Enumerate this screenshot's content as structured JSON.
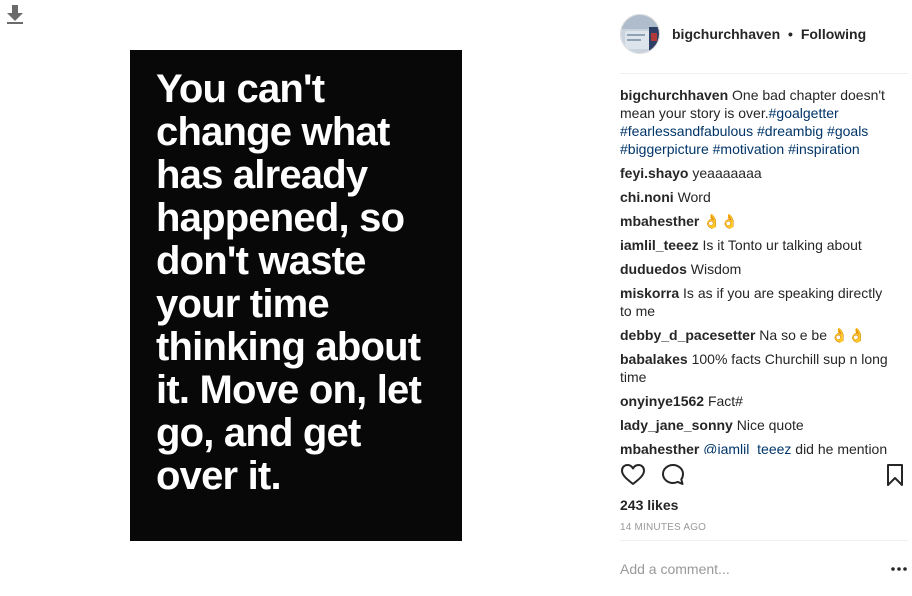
{
  "post": {
    "quote_lines": [
      "You can't",
      "change what",
      "has already",
      "happened, so",
      "don't waste",
      "your time",
      "thinking about",
      "it. Move on, let",
      "go, and get",
      "over it."
    ]
  },
  "header": {
    "username": "bigchurchhaven",
    "separator": "•",
    "follow_status": "Following"
  },
  "caption": {
    "username": "bigchurchhaven",
    "text": "One bad chapter doesn't mean your story is over.",
    "hashtags": [
      "#goalgetter",
      "#fearlessandfabulous",
      "#dreambig",
      "#goals",
      "#biggerpicture",
      "#motivation",
      "#inspiration"
    ]
  },
  "comments": [
    {
      "user": "feyi.shayo",
      "text": "yeaaaaaaa"
    },
    {
      "user": "chi.noni",
      "text": "Word"
    },
    {
      "user": "mbahesther",
      "text": "👌👌"
    },
    {
      "user": "iamlil_teeez",
      "text": "Is it Tonto ur talking about"
    },
    {
      "user": "duduedos",
      "text": "Wisdom"
    },
    {
      "user": "miskorra",
      "text": "Is as if you are speaking directly to me"
    },
    {
      "user": "debby_d_pacesetter",
      "text": "Na so e be 👌👌"
    },
    {
      "user": "babalakes",
      "text": "100% facts Churchill sup n long time"
    },
    {
      "user": "onyinye1562",
      "text": "Fact#"
    },
    {
      "user": "lady_jane_sonny",
      "text": "Nice quote"
    },
    {
      "user": "mbahesther",
      "mention": "@iamlil_teeez",
      "text": "did he mention"
    }
  ],
  "stats": {
    "likes": "243 likes",
    "time": "14 MINUTES AGO"
  },
  "comment_box": {
    "placeholder": "Add a comment..."
  },
  "icons": {
    "download": "download-arrow-icon",
    "like": "heart-icon",
    "comment": "comment-bubble-icon",
    "save": "bookmark-icon",
    "more": "more-options-icon"
  },
  "colors": {
    "link": "#003569",
    "text": "#262626",
    "muted": "#999999",
    "image_bg": "#080808"
  }
}
